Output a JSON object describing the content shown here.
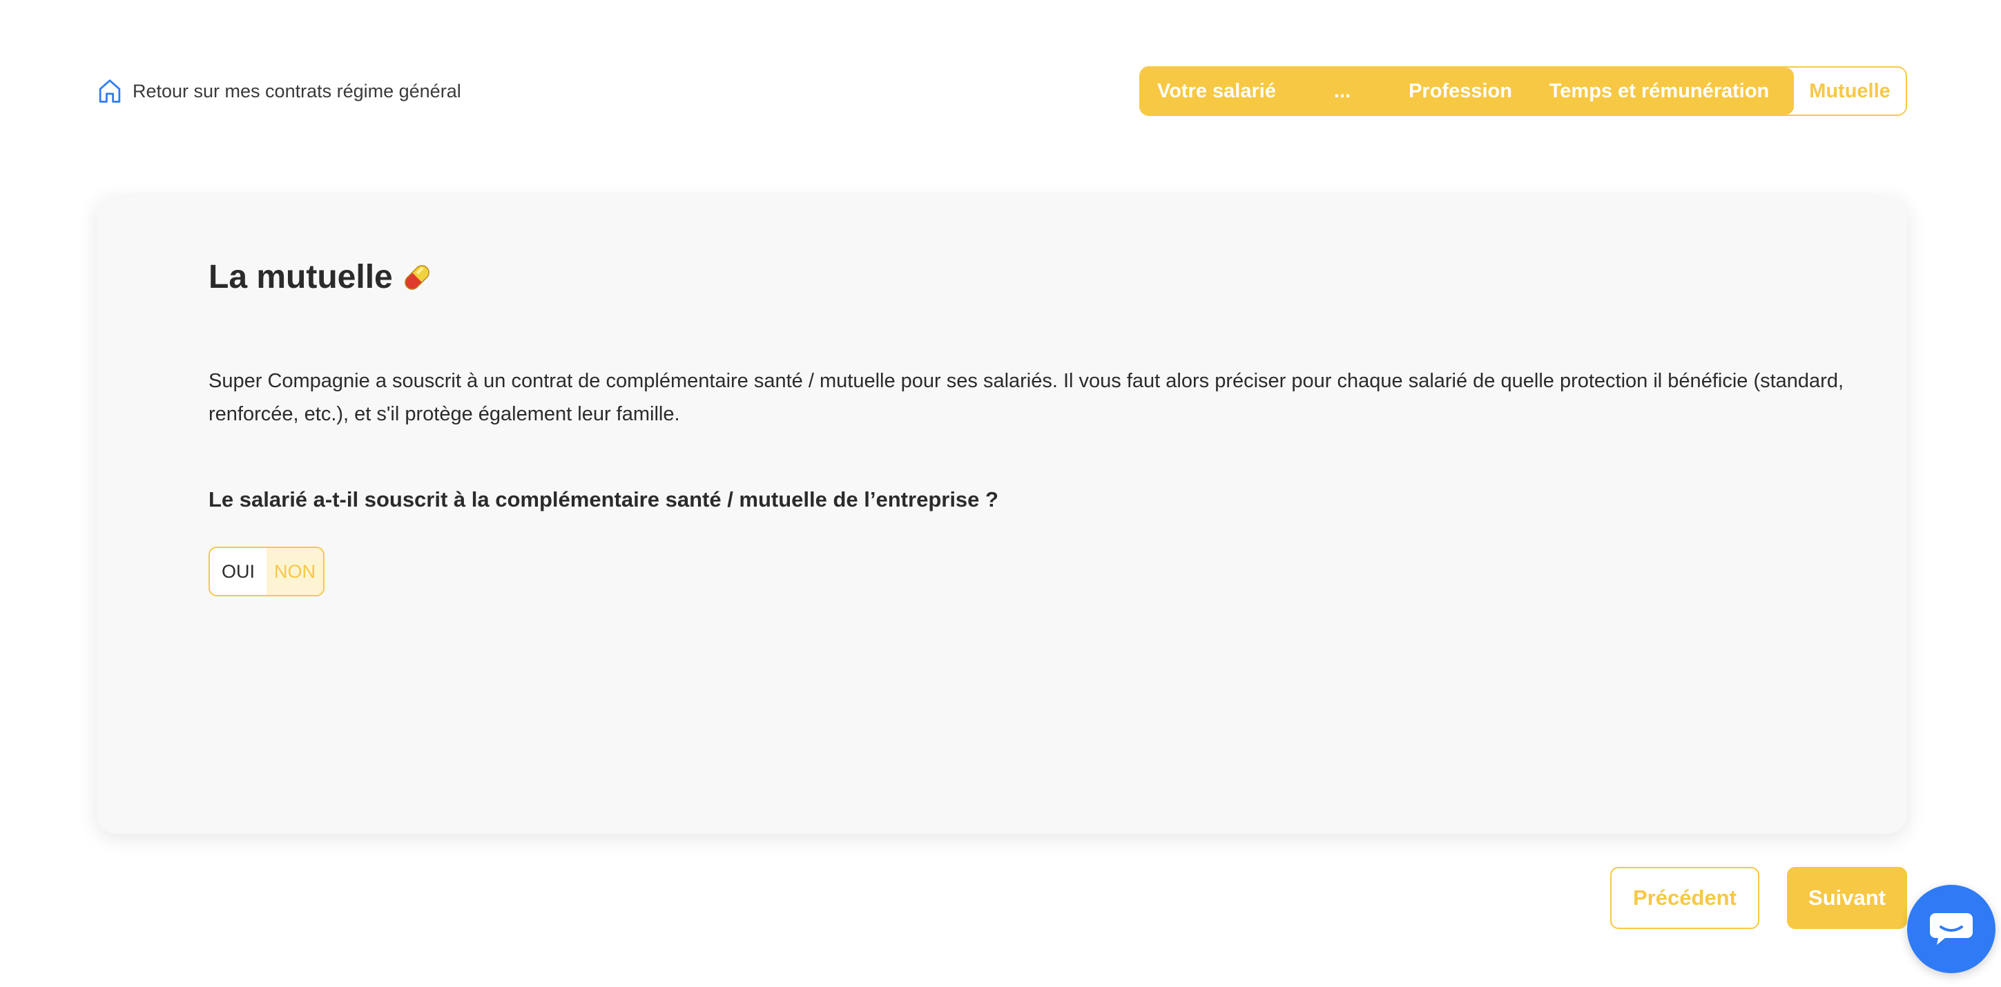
{
  "header": {
    "back_link_label": "Retour sur mes contrats régime général",
    "back_icon": "home-icon"
  },
  "stepper": {
    "steps": [
      {
        "label": "Votre salarié",
        "state": "done"
      },
      {
        "label": "...",
        "state": "done"
      },
      {
        "label": "Profession",
        "state": "done"
      },
      {
        "label": "Temps et rémunération",
        "state": "done"
      },
      {
        "label": "Mutuelle",
        "state": "active"
      }
    ]
  },
  "card": {
    "title": "La mutuelle",
    "title_icon": "pill-icon",
    "description": "Super Compagnie a souscrit à un contrat de complémentaire santé / mutuelle pour ses salariés. Il vous faut alors préciser pour chaque salarié de quelle protection il bénéficie (standard, renforcée, etc.), et s'il protège également leur famille.",
    "question": "Le salarié a-t-il souscrit à la complémentaire santé / mutuelle de l’entreprise ?",
    "options": {
      "yes": "OUI",
      "no": "NON",
      "selected": "NON"
    }
  },
  "navigation": {
    "previous_label": "Précédent",
    "next_label": "Suivant"
  },
  "chat": {
    "icon": "chat-icon"
  },
  "colors": {
    "accent": "#f7c844",
    "accent_light": "#fdf4d4",
    "chat_blue": "#2f7bf5",
    "home_icon_blue": "#2f7bf5",
    "card_bg": "#f8f8f8"
  }
}
